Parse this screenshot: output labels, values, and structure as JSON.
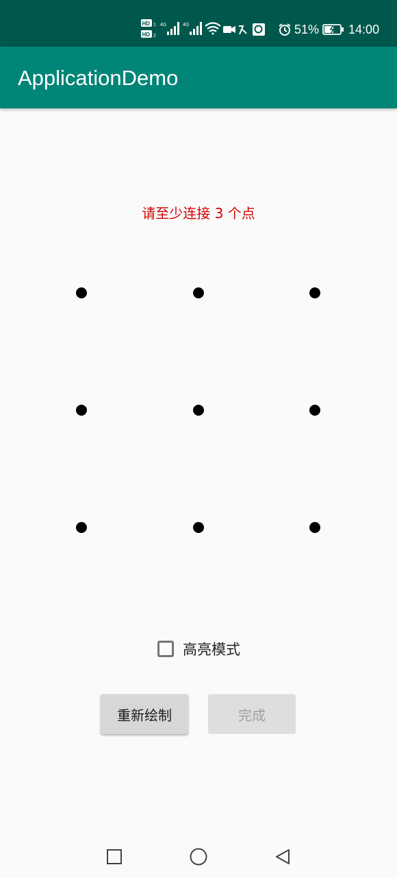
{
  "status_bar": {
    "battery_percent": "51%",
    "time": "14:00",
    "icons": [
      "hd-icon",
      "signal-4g-icon",
      "signal-4g-icon",
      "wifi-icon",
      "video-icon",
      "bluetooth-icon",
      "app-notification-icon",
      "alarm-icon",
      "battery-charging-icon"
    ]
  },
  "app_bar": {
    "title": "ApplicationDemo"
  },
  "main": {
    "hint": "请至少连接 3 个点",
    "hint_color": "#d50000",
    "pattern_dots": 9,
    "highlight_checkbox": {
      "label": "高亮模式",
      "checked": false
    },
    "buttons": {
      "redraw": "重新绘制",
      "done": "完成"
    }
  },
  "nav_bar": {
    "icons": [
      "recent-apps-icon",
      "home-icon",
      "back-icon"
    ]
  },
  "colors": {
    "primary": "#008577",
    "primary_dark": "#00574b",
    "accent": "#d50000"
  }
}
